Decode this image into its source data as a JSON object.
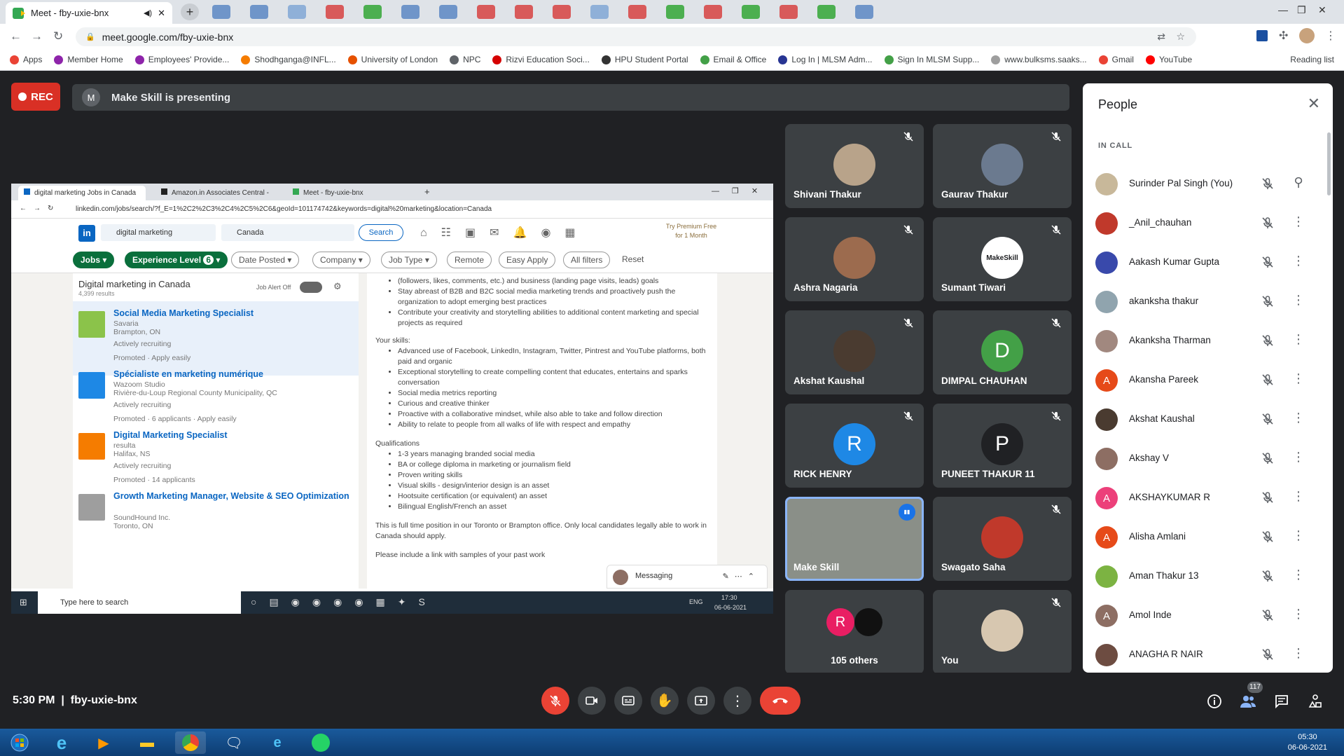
{
  "browser": {
    "active_tab_title": "Meet - fby-uxie-bnx",
    "url": "meet.google.com/fby-uxie-bnx",
    "bookmarks": [
      {
        "label": "Apps",
        "color": "#ea4335"
      },
      {
        "label": "Member Home",
        "color": "#8e24aa"
      },
      {
        "label": "Employees' Provide...",
        "color": "#8e24aa"
      },
      {
        "label": "Shodhganga@INFL...",
        "color": "#f57c00"
      },
      {
        "label": "University of London",
        "color": "#e65100"
      },
      {
        "label": "NPC",
        "color": "#5f6368"
      },
      {
        "label": "Rizvi Education Soci...",
        "color": "#d50000"
      },
      {
        "label": "HPU Student Portal",
        "color": "#333333"
      },
      {
        "label": "Email & Office",
        "color": "#43a047"
      },
      {
        "label": "Log In | MLSM Adm...",
        "color": "#283593"
      },
      {
        "label": "Sign In MLSM Supp...",
        "color": "#43a047"
      },
      {
        "label": "www.bulksms.saaks...",
        "color": "#9e9e9e"
      },
      {
        "label": "Gmail",
        "color": "#ea4335"
      },
      {
        "label": "YouTube",
        "color": "#ff0000"
      }
    ],
    "reading_list": "Reading list"
  },
  "meet": {
    "rec_label": "REC",
    "presenter_initial": "M",
    "presenting_text": "Make Skill is presenting",
    "time": "5:30 PM",
    "meeting_code": "fby-uxie-bnx",
    "people_count": "117"
  },
  "shared_screen": {
    "tabs": [
      "digital marketing Jobs in Canada",
      "Amazon.in Associates Central -",
      "Meet - fby-uxie-bnx"
    ],
    "url": "linkedin.com/jobs/search/?f_E=1%2C2%2C3%2C4%2C5%2C6&geoId=101174742&keywords=digital%20marketing&location=Canada",
    "search_keyword": "digital marketing",
    "search_location": "Canada",
    "search_button": "Search",
    "premium": [
      "Try Premium Free",
      "for 1 Month"
    ],
    "filters": [
      "Jobs",
      "Experience Level",
      "Date Posted",
      "Company",
      "Job Type",
      "Remote",
      "Easy Apply",
      "All filters",
      "Reset"
    ],
    "experience_count": "6",
    "results_title": "Digital marketing in Canada",
    "results_count": "4,399 results",
    "job_alert": "Job Alert Off",
    "jobs": [
      {
        "title": "Social Media Marketing Specialist",
        "company": "Savaria",
        "location": "Brampton, ON",
        "status": "Actively recruiting",
        "footer": "Promoted · Apply easily",
        "logo": "#8bc34a"
      },
      {
        "title": "Spécialiste en marketing numérique",
        "company": "Wazoom Studio",
        "location": "Rivière-du-Loup Regional County Municipality, QC",
        "status": "Actively recruiting",
        "footer": "Promoted · 6 applicants · Apply easily",
        "logo": "#1e88e5"
      },
      {
        "title": "Digital Marketing Specialist",
        "company": "resulta",
        "location": "Halifax, NS",
        "status": "Actively recruiting",
        "footer": "Promoted · 14 applicants",
        "logo": "#f57c00"
      },
      {
        "title": "Growth Marketing Manager, Website & SEO Optimization",
        "company": "SoundHound Inc.",
        "location": "Toronto, ON",
        "status": "",
        "footer": "",
        "logo": "#9e9e9e"
      }
    ],
    "detail": {
      "top_bullets": [
        "(followers, likes, comments, etc.) and business (landing page visits, leads) goals",
        "Stay abreast of B2B and B2C social media marketing trends and proactively push the organization to adopt emerging best practices",
        "Contribute your creativity and storytelling abilities to additional content marketing and special projects as required"
      ],
      "skills_heading": "Your skills:",
      "skills": [
        "Advanced use of Facebook, LinkedIn, Instagram, Twitter, Pintrest and YouTube platforms, both paid and organic",
        "Exceptional storytelling to create compelling content that educates, entertains and sparks conversation",
        "Social media metrics reporting",
        "Curious and creative thinker",
        "Proactive with a collaborative mindset, while also able to take and follow direction",
        "Ability to relate to people from all walks of life with respect and empathy"
      ],
      "qual_heading": "Qualifications",
      "qualifications": [
        "1-3 years managing branded social media",
        "BA or college diploma in marketing or journalism field",
        "Proven writing skills",
        "Visual skills - design/interior design is an asset",
        "Hootsuite certification (or equivalent) an asset",
        "Bilingual English/French an asset"
      ],
      "closing": "This is full time position in our Toronto or Brampton office. Only local candidates legally able to work in Canada should apply.",
      "closing2": "Please include a link with samples of your past work"
    },
    "messaging": "Messaging",
    "taskbar_search": "Type here to search",
    "taskbar_lang": "ENG",
    "taskbar_time": "17:30",
    "taskbar_date": "06-06-2021"
  },
  "tiles": [
    {
      "name": "Shivani Thakur",
      "initial": "",
      "color": "#b8a38a",
      "muted": true
    },
    {
      "name": "Gaurav Thakur",
      "initial": "",
      "color": "#6b7a8f",
      "muted": true
    },
    {
      "name": "Ashra Nagaria",
      "initial": "",
      "color": "#9c6b4e",
      "muted": true
    },
    {
      "name": "Sumant Tiwari",
      "initial": "MakeSkill",
      "color": "#ffffff",
      "muted": true
    },
    {
      "name": "Akshat Kaushal",
      "initial": "",
      "color": "#4a3b30",
      "muted": true
    },
    {
      "name": "DIMPAL CHAUHAN",
      "initial": "D",
      "color": "#43a047",
      "muted": true
    },
    {
      "name": "RICK HENRY",
      "initial": "R",
      "color": "#1e88e5",
      "muted": true
    },
    {
      "name": "PUNEET THAKUR 11",
      "initial": "P",
      "color": "#202124",
      "muted": true
    },
    {
      "name": "Make Skill",
      "initial": "",
      "color": "#8a8f88",
      "muted": false
    },
    {
      "name": "Swagato Saha",
      "initial": "",
      "color": "#c0392b",
      "muted": true
    },
    {
      "name": "105 others",
      "initial": "R",
      "color": "#e91e63",
      "muted": false
    },
    {
      "name": "You",
      "initial": "",
      "color": "#d7c7b0",
      "muted": true
    }
  ],
  "people_panel": {
    "title": "People",
    "section": "IN CALL",
    "people": [
      {
        "name": "Surinder Pal Singh (You)",
        "initial": "",
        "color": "#c8b89a"
      },
      {
        "name": "_Anil_chauhan",
        "initial": "",
        "color": "#c0392b"
      },
      {
        "name": "Aakash Kumar Gupta",
        "initial": "",
        "color": "#3949ab"
      },
      {
        "name": "akanksha thakur",
        "initial": "",
        "color": "#90a4ae"
      },
      {
        "name": "Akanksha Tharman",
        "initial": "",
        "color": "#a1887f"
      },
      {
        "name": "Akansha Pareek",
        "initial": "A",
        "color": "#e64a19"
      },
      {
        "name": "Akshat Kaushal",
        "initial": "",
        "color": "#4a3b30"
      },
      {
        "name": "Akshay V",
        "initial": "",
        "color": "#8d6e63"
      },
      {
        "name": "AKSHAYKUMAR R",
        "initial": "A",
        "color": "#ec407a"
      },
      {
        "name": "Alisha Amlani",
        "initial": "A",
        "color": "#e64a19"
      },
      {
        "name": "Aman Thakur 13",
        "initial": "",
        "color": "#7cb342"
      },
      {
        "name": "Amol Inde",
        "initial": "A",
        "color": "#8d6e63"
      },
      {
        "name": "ANAGHA R NAIR",
        "initial": "",
        "color": "#6d4c41"
      }
    ]
  },
  "windows": {
    "time": "05:30",
    "date": "06-06-2021"
  }
}
